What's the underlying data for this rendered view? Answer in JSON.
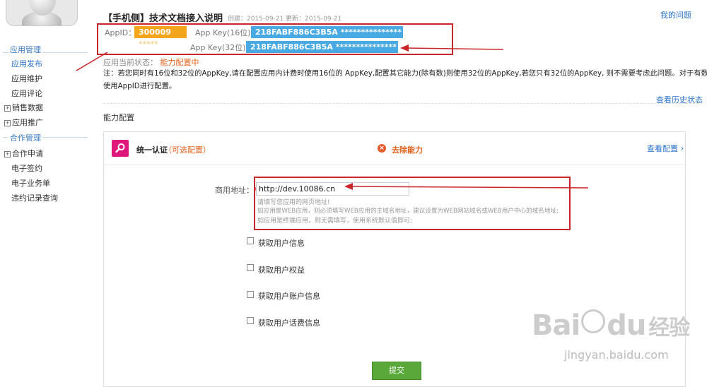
{
  "sidebar": {
    "section_app": "应用管理",
    "app_items": [
      "应用发布",
      "应用维护",
      "应用评论"
    ],
    "expand_items": [
      "销售数据",
      "应用推广"
    ],
    "section_coop": "合作管理",
    "coop_items": [
      "合作申请"
    ],
    "coop_sub_items": [
      "电子签约",
      "电子业务单",
      "违约记录查询"
    ]
  },
  "header": {
    "title": "【手机侧】技术文档接入说明",
    "created": "创建：2015-09-21",
    "updated": "更新：2015-09-21",
    "my_questions": "我的问题"
  },
  "keys": {
    "appid_label": "AppID：",
    "appid_value": "300009",
    "appid_masked": "*****",
    "appkey16_label": "App Key(16位)：",
    "appkey16_value": "218FABF886C3B5A ***************",
    "appkey32_label": "App Key(32位)：",
    "appkey32_value": "218FABF886C3B5A ***************"
  },
  "status": {
    "label": "应用当前状态：",
    "value": "能力配置中",
    "note_line1": "注：若您同时有16位和32位的AppKey,请在配置应用内计费时使用16位的 AppKey,配置其它能力(除有数)则使用32位的AppKey,若您只有32位的AppKey, 则不需要考虑此问题。对于有数能力,则",
    "note_line2": "使用AppID进行配置。",
    "history_link": "查看历史状态"
  },
  "capability": {
    "section_title": "能力配置",
    "name": "统一认证",
    "optional": "（可选配置）",
    "remove": "去除能力",
    "view_config": "查看配置"
  },
  "form": {
    "url_label": "商用地址：",
    "required_star": "*",
    "url_value": "http://dev.10086.cn",
    "hint1": "请填写您应用的网页地址!",
    "hint2": "如应用是WEB应用，则必须填写WEB应用的主域名地址，建议设置为WEB网站域名或WEB用户中心的域名地址;",
    "hint3": "如应用是终端应用，则无需填写，使用系统默认值即可;",
    "checkboxes": [
      "获取用户信息",
      "获取用户权益",
      "获取用户账户信息",
      "获取用户话费信息"
    ],
    "submit": "提交"
  },
  "watermark": {
    "brand_a": "Bai",
    "brand_b": "du",
    "brand_c": "经验",
    "url": "jingyan.baidu.com"
  },
  "colors": {
    "annotation_red": "#c9262c",
    "appid_orange": "#f3a51c",
    "key_blue": "#49a9e3",
    "accent_blue": "#2a73c9",
    "status_orange": "#e0621b",
    "capability_pink": "#e0177a",
    "submit_green": "#5aa73a"
  }
}
